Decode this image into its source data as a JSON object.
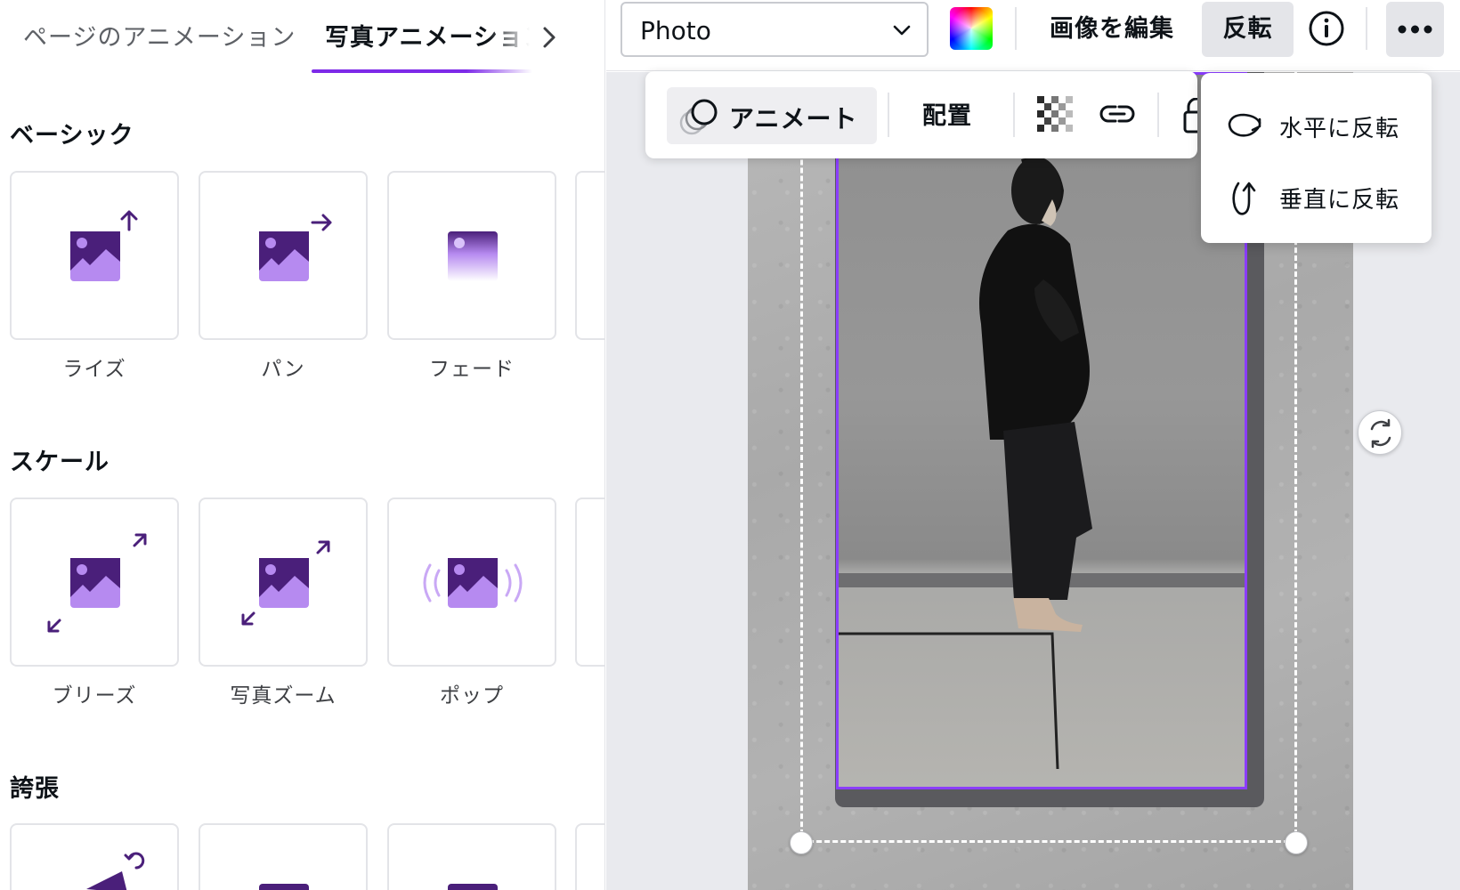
{
  "panel": {
    "tabs": [
      {
        "label": "ページのアニメーション"
      },
      {
        "label": "写真アニメーション"
      }
    ],
    "sections": [
      {
        "title": "ベーシック",
        "items": [
          {
            "label": "ライズ"
          },
          {
            "label": "パン"
          },
          {
            "label": "フェード"
          }
        ]
      },
      {
        "title": "スケール",
        "items": [
          {
            "label": "ブリーズ"
          },
          {
            "label": "写真ズーム"
          },
          {
            "label": "ポップ"
          }
        ]
      },
      {
        "title": "誇張",
        "items": []
      }
    ]
  },
  "toolbar": {
    "font_value": "Photo",
    "edit_image_label": "画像を編集",
    "flip_label": "反転"
  },
  "floating_toolbar": {
    "animate_label": "アニメート",
    "position_label": "配置"
  },
  "flip_menu": {
    "items": [
      {
        "label": "水平に反転"
      },
      {
        "label": "垂直に反転"
      }
    ]
  },
  "colors": {
    "accent": "#8b3dff",
    "thumb_dark": "#4a1f7a",
    "thumb_light": "#b68af0"
  }
}
